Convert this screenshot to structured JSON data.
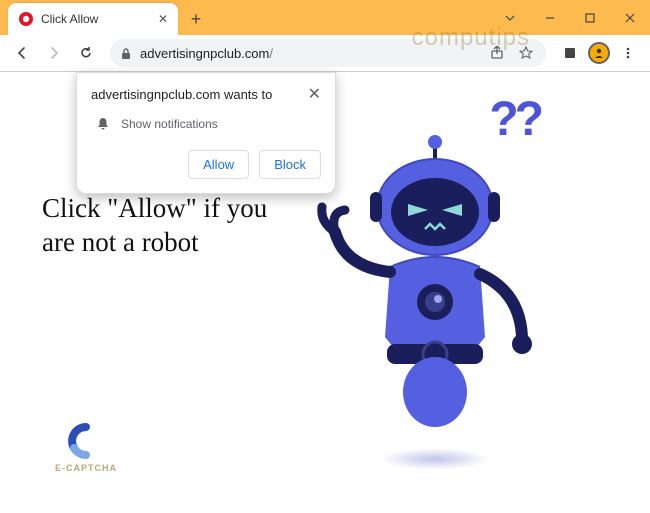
{
  "window": {
    "tab_title": "Click Allow",
    "watermark": "computips"
  },
  "toolbar": {
    "url_host": "advertisingnpclub.com",
    "url_path": "/"
  },
  "permission_dialog": {
    "domain_text": "advertisingnpclub.com wants to",
    "request_text": "Show notifications",
    "allow_label": "Allow",
    "block_label": "Block"
  },
  "page": {
    "headline": "Click \"Allow\" if you are not a robot",
    "captcha_label": "E-CAPTCHA",
    "question_marks": "??"
  }
}
